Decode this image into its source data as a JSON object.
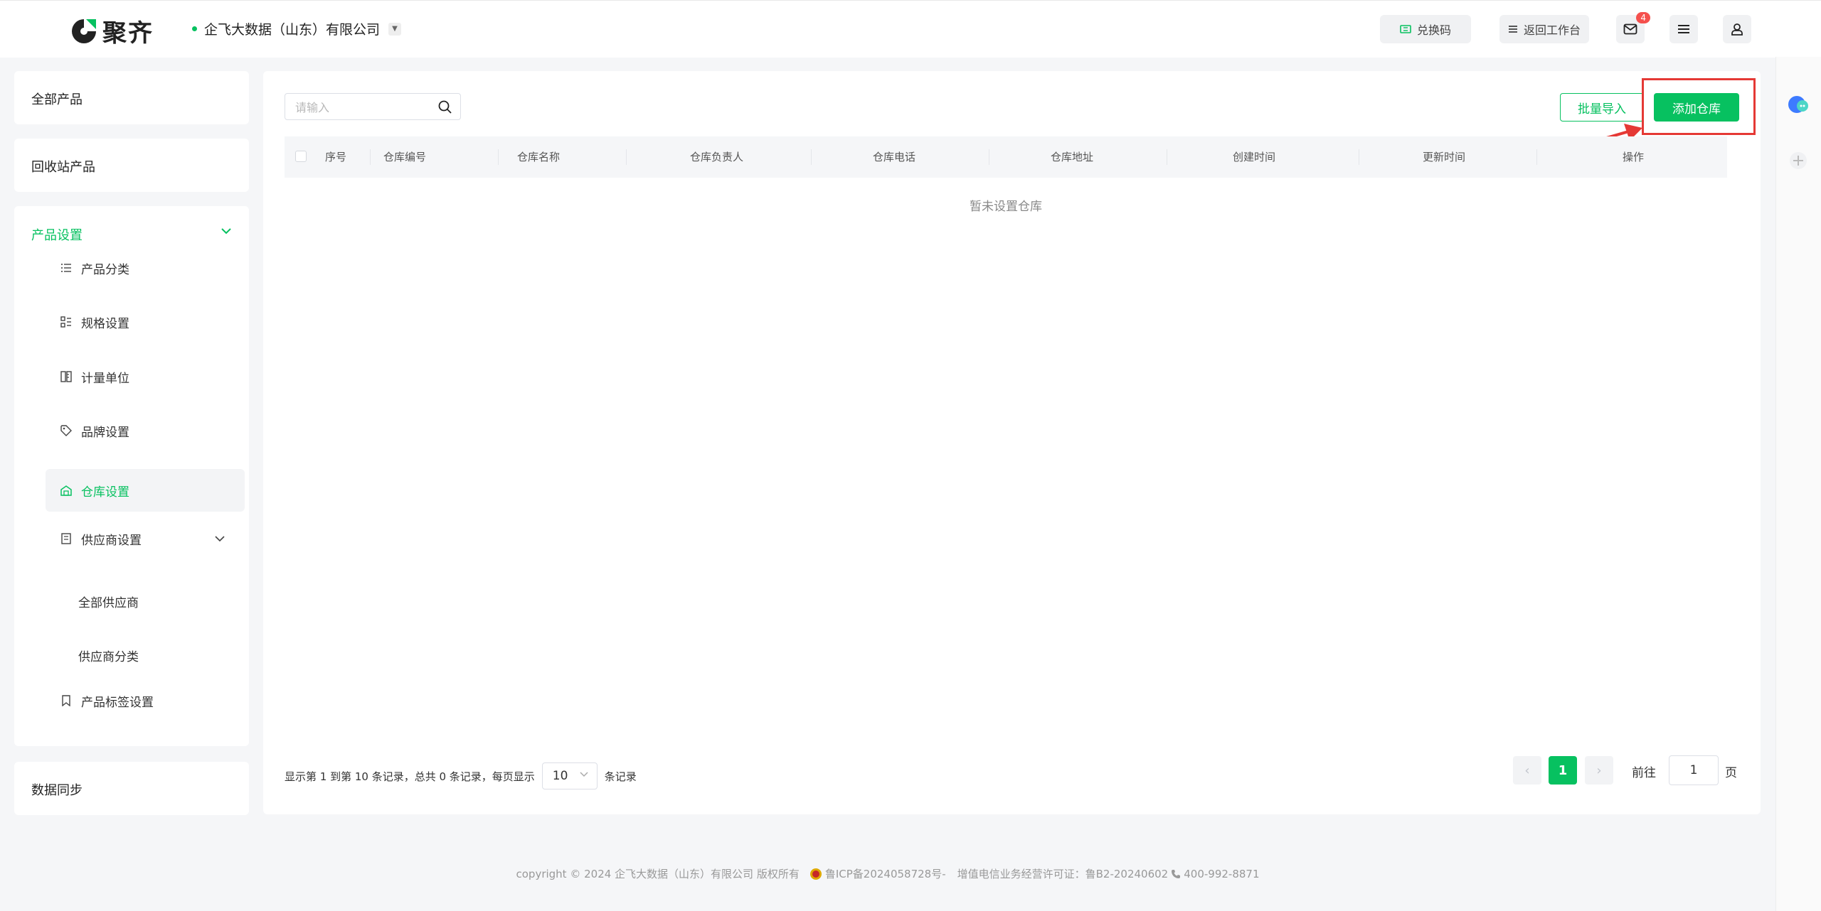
{
  "header": {
    "brand": "聚齐",
    "company": "企飞大数据（山东）有限公司",
    "redeem_label": "兑换码",
    "back_label": "返回工作台",
    "mail_count": "4"
  },
  "sidebar": {
    "all_products": "全部产品",
    "recycle_products": "回收站产品",
    "product_settings": "产品设置",
    "items": [
      {
        "label": "产品分类"
      },
      {
        "label": "规格设置"
      },
      {
        "label": "计量单位"
      },
      {
        "label": "品牌设置"
      },
      {
        "label": "仓库设置"
      },
      {
        "label": "供应商设置"
      },
      {
        "label": "全部供应商"
      },
      {
        "label": "供应商分类"
      },
      {
        "label": "产品标签设置"
      }
    ],
    "data_sync": "数据同步"
  },
  "toolbar": {
    "search_placeholder": "请输入",
    "batch_import": "批量导入",
    "add_warehouse": "添加仓库"
  },
  "table": {
    "columns": [
      "序号",
      "仓库编号",
      "仓库名称",
      "仓库负责人",
      "仓库电话",
      "仓库地址",
      "创建时间",
      "更新时间",
      "操作"
    ],
    "empty_text": "暂未设置仓库"
  },
  "pagination": {
    "info_prefix": "显示第 1 到第 10 条记录，总共 0 条记录，每页显示",
    "page_size": "10",
    "info_suffix": "条记录",
    "prev": "‹",
    "current_page": "1",
    "next": "›",
    "goto_label": "前往",
    "goto_value": "1",
    "page_unit": "页"
  },
  "footer": {
    "copyright": "copyright © 2024 企飞大数据（山东）有限公司 版权所有",
    "icp": "鲁ICP备2024058728号-",
    "license": "增值电信业务经营许可证：鲁B2-20240602",
    "phone": "400-992-8871"
  },
  "colors": {
    "accent": "#07c160",
    "highlight": "#e53935",
    "badge": "#f5504d"
  }
}
